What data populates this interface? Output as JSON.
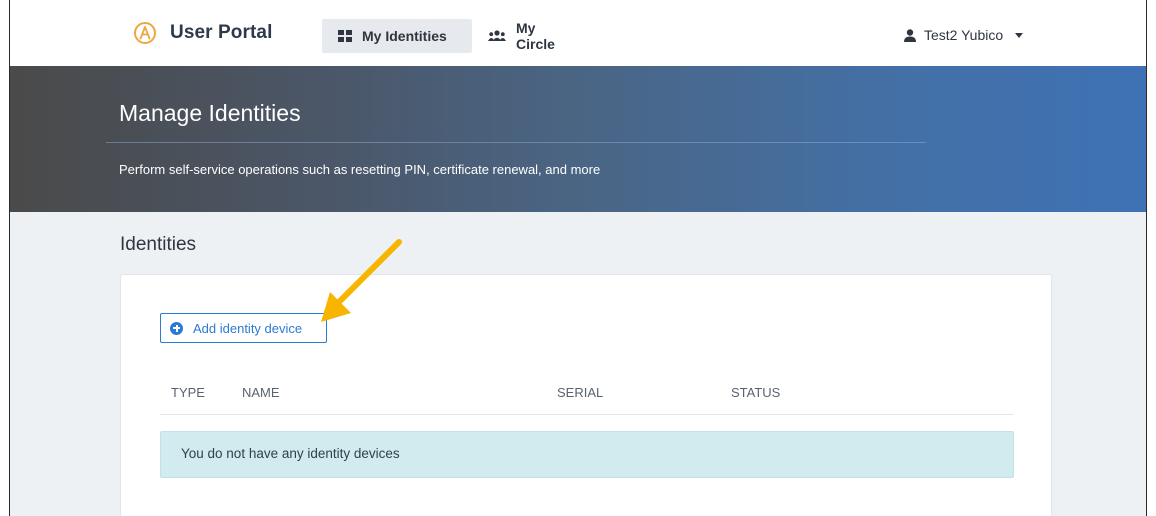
{
  "app": {
    "brand": "User Portal"
  },
  "nav": {
    "tabs": [
      {
        "label": "My Identities",
        "icon": "grid-icon",
        "active": true
      },
      {
        "label": "My Circle",
        "icon": "users-icon",
        "active": false
      }
    ],
    "user": {
      "label": "Test2 Yubico",
      "icon": "user-icon"
    }
  },
  "hero": {
    "title": "Manage Identities",
    "subtitle": "Perform self-service operations such as resetting PIN, certificate renewal, and more"
  },
  "identities": {
    "section_title": "Identities",
    "add_button_label": "Add identity device",
    "columns": [
      "TYPE",
      "NAME",
      "SERIAL",
      "STATUS"
    ],
    "empty_message": "You do not have any identity devices"
  },
  "colors": {
    "brand_accent": "#f0a640",
    "primary": "#2b7bd0",
    "alert_bg": "#d1ebef",
    "annotation_arrow": "#f7b500"
  }
}
